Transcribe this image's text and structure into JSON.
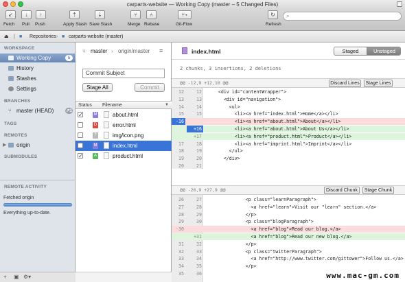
{
  "window": {
    "title": "carparts-website — Working Copy (master – 5 Changed Files)"
  },
  "toolbar": {
    "buttons": [
      {
        "label": "Fetch",
        "glyph": "↙"
      },
      {
        "label": "Pull",
        "glyph": "↓"
      },
      {
        "label": "Push",
        "glyph": "↑"
      },
      {
        "label": "Apply Stash",
        "glyph": "⇡"
      },
      {
        "label": "Save Stash",
        "glyph": "⇣"
      },
      {
        "label": "Merge",
        "glyph": "⑂"
      },
      {
        "label": "Rebase",
        "glyph": "⑃"
      },
      {
        "label": "Git-Flow",
        "glyph": "⑂▾"
      },
      {
        "label": "Refresh",
        "glyph": "↻"
      }
    ],
    "search_placeholder": ""
  },
  "pathbar": {
    "repositories": "Repositories",
    "repo": "carparts-website (master)"
  },
  "sidebar": {
    "workspace_heading": "WORKSPACE",
    "workspace_items": [
      {
        "label": "Working Copy",
        "badge": "5",
        "color": "#8da0b8"
      },
      {
        "label": "History",
        "color": "#8aa0bb"
      },
      {
        "label": "Stashes",
        "color": "#8aa0bb"
      },
      {
        "label": "Settings",
        "color": "#8c8c8c"
      }
    ],
    "branches_heading": "BRANCHES",
    "branch": {
      "label": "master (HEAD)",
      "badge": "↗1"
    },
    "tags_heading": "TAGS",
    "remotes_heading": "REMOTES",
    "remote": {
      "label": "origin"
    },
    "submodules_heading": "SUBMODULES",
    "activity": {
      "heading": "REMOTE ACTIVITY",
      "task": "Fetched origin",
      "progress": 1.0,
      "status": "Everything up-to-date."
    }
  },
  "middle": {
    "branch": "master",
    "upstream": "origin/master",
    "commit_placeholder": "Commit Subject",
    "stage_all": "Stage All",
    "commit": "Commit",
    "col_status": "Status",
    "col_filename": "Filename",
    "files": [
      {
        "name": "about.html",
        "checked": true,
        "status": "M",
        "status_color": "#8a7cd8",
        "selected": false
      },
      {
        "name": "error.html",
        "checked": false,
        "status": "D",
        "status_color": "#d84b3f",
        "selected": false
      },
      {
        "name": "img/icon.png",
        "checked": false,
        "status": "?",
        "status_color": "#b8b8b8",
        "selected": false
      },
      {
        "name": "index.html",
        "checked": false,
        "status": "M",
        "status_color": "#8a7cd8",
        "selected": true
      },
      {
        "name": "product.html",
        "checked": true,
        "status": "A",
        "status_color": "#5bb85b",
        "selected": false
      }
    ]
  },
  "diff": {
    "file": "index.html",
    "tab_staged": "Staged",
    "tab_unstaged": "Unstaged",
    "summary": "2 chunks, 3 insertions, 2 deletions",
    "hunks": [
      {
        "header": "@@ -12,9 +12,10 @@",
        "buttons": [
          "Discard Lines",
          "Stage Lines"
        ],
        "lines": [
          {
            "o": "12",
            "n": "12",
            "t": "",
            "c": "    <div id=\"contentWrapper\">"
          },
          {
            "o": "13",
            "n": "13",
            "t": "",
            "c": "      <div id=\"navigation\">"
          },
          {
            "o": "14",
            "n": "14",
            "t": "",
            "c": "        <ul>"
          },
          {
            "o": "15",
            "n": "15",
            "t": "",
            "c": "          <li><a href=\"index.html\">Home</a></li>"
          },
          {
            "o": "-16",
            "n": "",
            "t": "del",
            "c": "          <li><a href=\"about.html\">About</a></li>"
          },
          {
            "o": "",
            "n": "+16",
            "t": "add",
            "c": "          <li><a href=\"about.html\">About Us</a></li>"
          },
          {
            "o": "",
            "n": "+17",
            "t": "add2",
            "c": "          <li><a href=\"product.html\">Product</a></li>"
          },
          {
            "o": "17",
            "n": "18",
            "t": "",
            "c": "          <li><a href=\"imprint.html\">Imprint</a></li>"
          },
          {
            "o": "18",
            "n": "19",
            "t": "",
            "c": "        </ul>"
          },
          {
            "o": "19",
            "n": "20",
            "t": "",
            "c": "      </div>"
          },
          {
            "o": "20",
            "n": "21",
            "t": "",
            "c": ""
          }
        ]
      },
      {
        "header": "@@ -26,9 +27,9 @@",
        "buttons": [
          "Discard Chunk",
          "Stage Chunk"
        ],
        "lines": [
          {
            "o": "26",
            "n": "27",
            "t": "",
            "c": "              <p class=\"learnParagraph\">"
          },
          {
            "o": "27",
            "n": "28",
            "t": "",
            "c": "                <a href=\"learn\">Visit our \"learn\" section.</a>"
          },
          {
            "o": "28",
            "n": "29",
            "t": "",
            "c": "              </p>"
          },
          {
            "o": "29",
            "n": "30",
            "t": "",
            "c": "              <p class=\"blogParagraph\">"
          },
          {
            "o": "-30",
            "n": "",
            "t": "del",
            "c": "                <a href=\"blog\">Read our blog.</a>"
          },
          {
            "o": "",
            "n": "+31",
            "t": "add",
            "c": "                <a href=\"blog\">Read our new blog.</a>"
          },
          {
            "o": "31",
            "n": "32",
            "t": "",
            "c": "              </p>"
          },
          {
            "o": "32",
            "n": "33",
            "t": "",
            "c": "              <p class=\"twitterParagraph\">"
          },
          {
            "o": "33",
            "n": "34",
            "t": "",
            "c": "                <a href=\"http://www.twitter.com/gittower\">Follow us.</a>"
          },
          {
            "o": "34",
            "n": "35",
            "t": "",
            "c": "              </p>"
          },
          {
            "o": "35",
            "n": "36",
            "t": "",
            "c": ""
          }
        ]
      }
    ]
  },
  "watermark": "www.mac-gm.com"
}
